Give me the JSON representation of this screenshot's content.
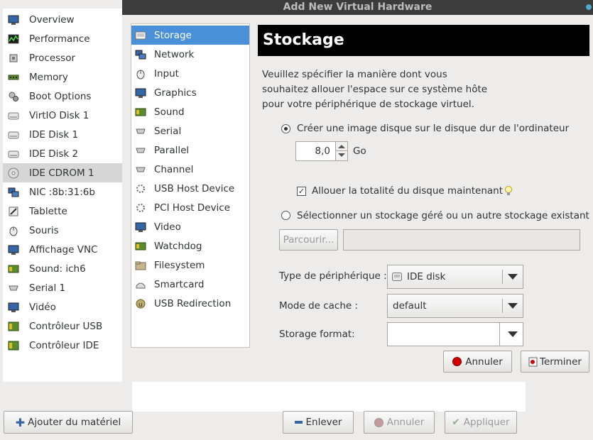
{
  "dialog": {
    "title": "Add New Virtual Hardware"
  },
  "sidebar": {
    "items": [
      {
        "label": "Overview",
        "icon": "monitor-icon"
      },
      {
        "label": "Performance",
        "icon": "performance-graph-icon"
      },
      {
        "label": "Processor",
        "icon": "cpu-chip-icon"
      },
      {
        "label": "Memory",
        "icon": "memory-module-icon"
      },
      {
        "label": "Boot Options",
        "icon": "gears-icon"
      },
      {
        "label": "VirtIO Disk 1",
        "icon": "hard-disk-icon"
      },
      {
        "label": "IDE Disk 1",
        "icon": "hard-disk-icon"
      },
      {
        "label": "IDE Disk 2",
        "icon": "hard-disk-icon"
      },
      {
        "label": "IDE CDROM 1",
        "icon": "cdrom-icon"
      },
      {
        "label": "NIC :8b:31:6b",
        "icon": "network-icon"
      },
      {
        "label": "Tablette",
        "icon": "tablet-icon"
      },
      {
        "label": "Souris",
        "icon": "mouse-icon"
      },
      {
        "label": "Affichage VNC",
        "icon": "display-icon"
      },
      {
        "label": "Sound: ich6",
        "icon": "sound-card-icon"
      },
      {
        "label": "Serial 1",
        "icon": "serial-port-icon"
      },
      {
        "label": "Vidéo",
        "icon": "video-icon"
      },
      {
        "label": "Contrôleur USB",
        "icon": "controller-card-icon"
      },
      {
        "label": "Contrôleur IDE",
        "icon": "controller-card-icon"
      }
    ],
    "selected_index": 8
  },
  "hardware_list": {
    "items": [
      {
        "label": "Storage",
        "icon": "storage-icon"
      },
      {
        "label": "Network",
        "icon": "network-icon"
      },
      {
        "label": "Input",
        "icon": "mouse-icon"
      },
      {
        "label": "Graphics",
        "icon": "display-icon"
      },
      {
        "label": "Sound",
        "icon": "sound-card-icon"
      },
      {
        "label": "Serial",
        "icon": "serial-port-icon"
      },
      {
        "label": "Parallel",
        "icon": "parallel-port-icon"
      },
      {
        "label": "Channel",
        "icon": "channel-icon"
      },
      {
        "label": "USB Host Device",
        "icon": "usb-device-icon"
      },
      {
        "label": "PCI Host Device",
        "icon": "pci-device-icon"
      },
      {
        "label": "Video",
        "icon": "video-icon"
      },
      {
        "label": "Watchdog",
        "icon": "watchdog-icon"
      },
      {
        "label": "Filesystem",
        "icon": "folder-icon"
      },
      {
        "label": "Smartcard",
        "icon": "smartcard-icon"
      },
      {
        "label": "USB Redirection",
        "icon": "usb-redirection-icon"
      }
    ],
    "selected_index": 0
  },
  "storage": {
    "header": "Stockage",
    "description_lines": [
      "Veuillez spécifier la manière dont vous",
      "souhaitez allouer l'espace sur ce système hôte",
      "pour votre périphérique de stockage virtuel."
    ],
    "option_create": "Créer une image disque sur le disque dur de l'ordinateur",
    "option_create_selected": true,
    "size_value": "8,0",
    "size_unit": "Go",
    "allocate_label": "Allouer la totalité du disque maintenant",
    "allocate_checked": true,
    "option_existing": "Sélectionner un stockage géré ou un autre stockage existant",
    "browse_label": "Parcourir...",
    "browse_path": "",
    "device_type_label": "Type de périphérique :",
    "device_type_value": "IDE disk",
    "cache_mode_label": "Mode de cache :",
    "cache_mode_value": "default",
    "storage_format_label": "Storage format:",
    "storage_format_value": ""
  },
  "dialog_buttons": {
    "cancel": "Annuler",
    "finish": "Terminer"
  },
  "bottom_bar": {
    "add_hardware": "Ajouter du matériel",
    "remove": "Enlever",
    "cancel": "Annuler",
    "apply": "Appliquer"
  },
  "colors": {
    "selection": "#4a90d9",
    "header_bg": "#000000",
    "titlebar_bg": "#3c3c3c"
  }
}
